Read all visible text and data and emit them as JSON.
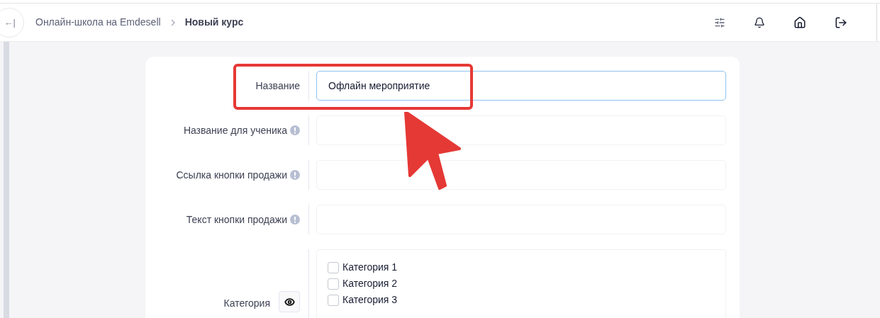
{
  "header": {
    "back_glyph": "←|",
    "breadcrumbs": [
      {
        "label": "Онлайн-школа на Emdesell",
        "current": false
      },
      {
        "label": "Новый курс",
        "current": true
      }
    ]
  },
  "form": {
    "fields": [
      {
        "kind": "text",
        "label": "Название",
        "value": "Офлайн мероприятие",
        "focused": true,
        "hint": false
      },
      {
        "kind": "text",
        "label": "Название для ученика",
        "focused": false,
        "hint": true
      },
      {
        "kind": "text",
        "label": "Ссылка кнопки продажи",
        "focused": false,
        "hint": true
      },
      {
        "kind": "text",
        "label": "Текст кнопки продажи",
        "focused": false,
        "hint": true
      },
      {
        "kind": "checklist",
        "label": "Категория",
        "options": [
          {
            "label": "Категория 1",
            "checked": false
          },
          {
            "label": "Категория 2",
            "checked": false
          },
          {
            "label": "Категория 3",
            "checked": false
          }
        ]
      }
    ]
  }
}
